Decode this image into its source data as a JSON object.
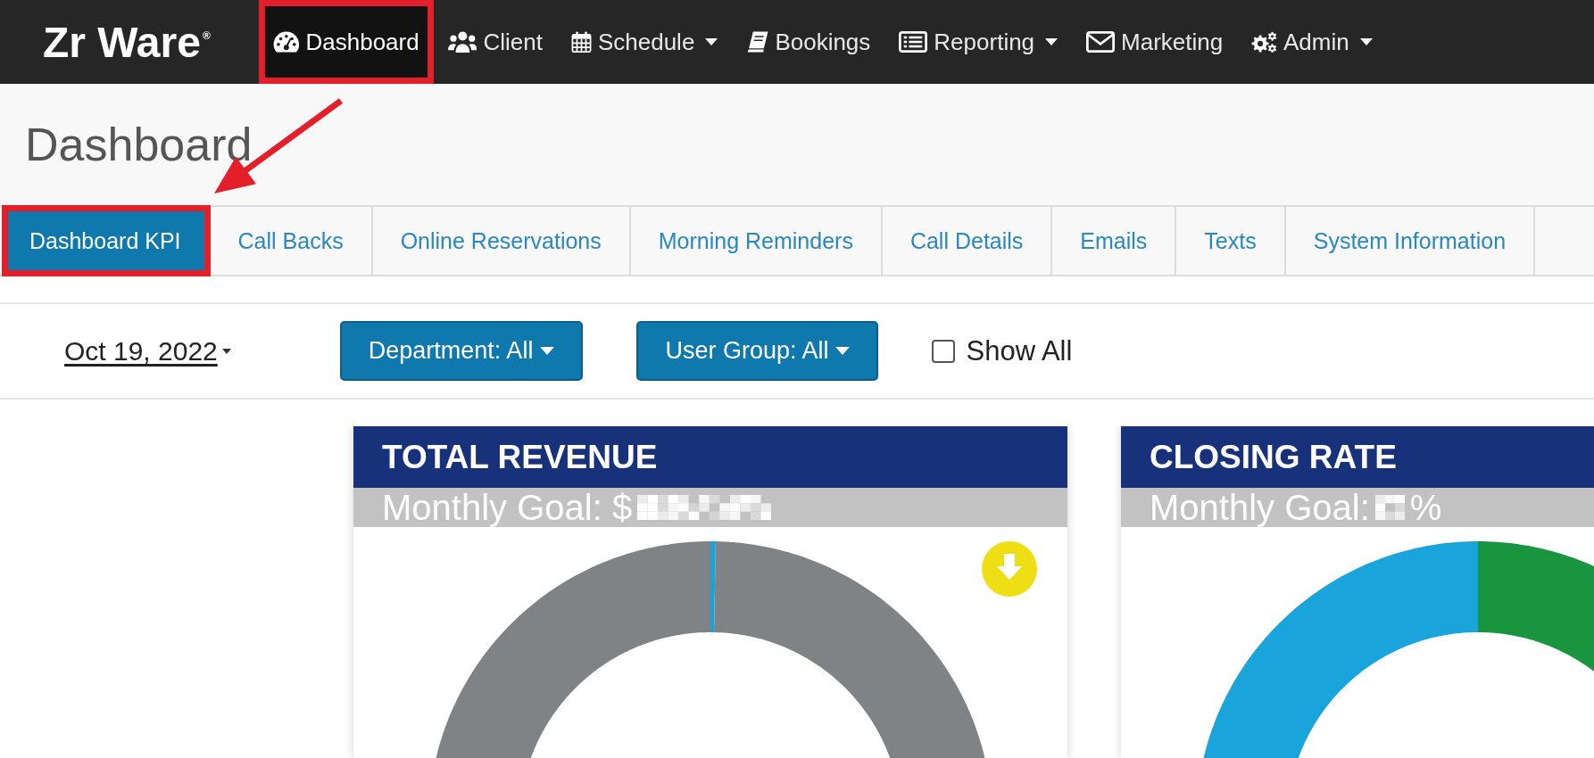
{
  "nav": {
    "brand": "Zr Ware$^{®}$",
    "items": [
      {
        "label": "Dashboard",
        "dropdown": false,
        "selected": true,
        "highlighted": true
      },
      {
        "label": "Client",
        "dropdown": false,
        "selected": false,
        "highlighted": false
      },
      {
        "label": "Schedule",
        "dropdown": true,
        "selected": false,
        "highlighted": false
      },
      {
        "label": "Bookings",
        "dropdown": false,
        "selected": false,
        "highlighted": false
      },
      {
        "label": "Reporting",
        "dropdown": true,
        "selected": false,
        "highlighted": false
      },
      {
        "label": "Marketing",
        "dropdown": false,
        "selected": false,
        "highlighted": false
      },
      {
        "label": "Admin",
        "dropdown": true,
        "selected": false,
        "highlighted": false
      }
    ]
  },
  "page": {
    "title": "Dashboard"
  },
  "tabs": [
    {
      "label": "Dashboard KPI",
      "selected": true,
      "highlighted": true
    },
    {
      "label": "Call Backs",
      "selected": false,
      "highlighted": false
    },
    {
      "label": "Online Reservations",
      "selected": false,
      "highlighted": false
    },
    {
      "label": "Morning Reminders",
      "selected": false,
      "highlighted": false
    },
    {
      "label": "Call Details",
      "selected": false,
      "highlighted": false
    },
    {
      "label": "Emails",
      "selected": false,
      "highlighted": false
    },
    {
      "label": "Texts",
      "selected": false,
      "highlighted": false
    },
    {
      "label": "System Information",
      "selected": false,
      "highlighted": false
    }
  ],
  "filters": {
    "date": "Oct 19, 2022",
    "dropdowns": [
      "Department: All",
      "User Group: All"
    ],
    "show_all": {
      "label": "Show All",
      "checked": false
    }
  },
  "cards": [
    {
      "kind": "currency",
      "title": "TOTAL REVENUE",
      "goal": "Monthly Goal: $",
      "goal_redacted": true,
      "download": true
    },
    {
      "kind": "percent",
      "title": "CLOSING RATE",
      "goal": "Monthly Goal:",
      "goal_redacted": true,
      "goal_unit": "%",
      "download": false
    }
  ]
}
